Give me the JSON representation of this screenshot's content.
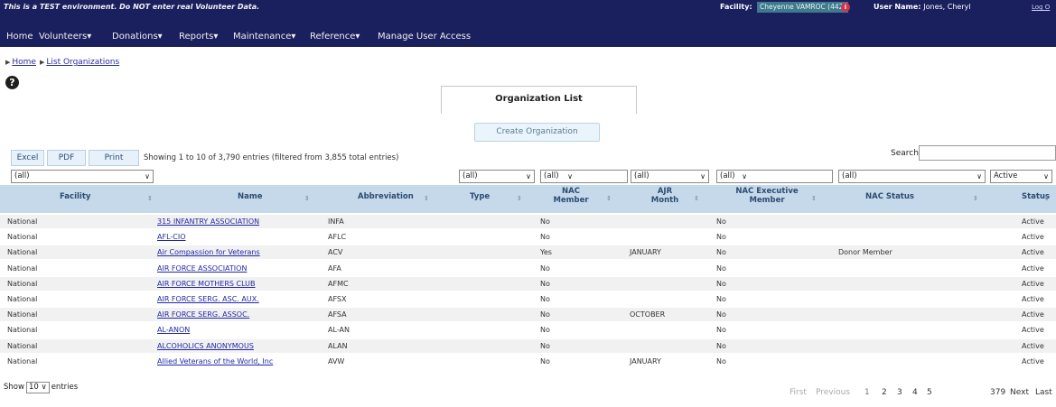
{
  "banner": {
    "warning": "This is a TEST environment. Do NOT enter real Volunteer Data.",
    "facility_label": "Facility:",
    "facility_value": "Cheyenne VAMROC (442)",
    "user_label": "User Name:",
    "user_name": "Jones, Cheryl",
    "logout": "Log O"
  },
  "nav": {
    "items": [
      "Home",
      "Volunteers",
      "Donations",
      "Reports",
      "Maintenance",
      "Reference",
      "Manage User Access"
    ]
  },
  "breadcrumb": [
    "Home",
    "List Organizations"
  ],
  "page": {
    "title": "Organization List",
    "create_button": "Create Organization"
  },
  "toolbar": {
    "excel": "Excel",
    "pdf": "PDF",
    "print": "Print",
    "showing": "Showing 1 to 10 of 3,790 entries (filtered from 3,855 total entries)",
    "search_label": "Search:"
  },
  "filters": {
    "facility": "(all)",
    "type": "(all)",
    "nac_member": "(all)",
    "ajr_month": "(all)",
    "nac_exec": "(all)",
    "nac_status": "(all)",
    "status": "Active"
  },
  "table": {
    "columns": [
      "Facility",
      "Name",
      "Abbreviation",
      "Type",
      "NAC Member",
      "AJR Month",
      "NAC Executive Member",
      "NAC Status",
      "Status"
    ],
    "rows": [
      [
        "National",
        "315 INFANTRY ASSOCIATION",
        "INFA",
        "",
        "No",
        "",
        "No",
        "",
        "Active"
      ],
      [
        "National",
        "AFL-CIO",
        "AFLC",
        "",
        "No",
        "",
        "No",
        "",
        "Active"
      ],
      [
        "National",
        "Air Compassion for Veterans",
        "ACV",
        "",
        "Yes",
        "JANUARY",
        "No",
        "Donor Member",
        "Active"
      ],
      [
        "National",
        "AIR FORCE ASSOCIATION",
        "AFA",
        "",
        "No",
        "",
        "No",
        "",
        "Active"
      ],
      [
        "National",
        "AIR FORCE MOTHERS CLUB",
        "AFMC",
        "",
        "No",
        "",
        "No",
        "",
        "Active"
      ],
      [
        "National",
        "AIR FORCE SERG. ASC. AUX.",
        "AFSX",
        "",
        "No",
        "",
        "No",
        "",
        "Active"
      ],
      [
        "National",
        "AIR FORCE SERG. ASSOC.",
        "AFSA",
        "",
        "No",
        "OCTOBER",
        "No",
        "",
        "Active"
      ],
      [
        "National",
        "AL-ANON",
        "AL-AN",
        "",
        "No",
        "",
        "No",
        "",
        "Active"
      ],
      [
        "National",
        "ALCOHOLICS ANONYMOUS",
        "ALAN",
        "",
        "No",
        "",
        "No",
        "",
        "Active"
      ],
      [
        "National",
        "Allied Veterans of the World, Inc",
        "AVW",
        "",
        "No",
        "JANUARY",
        "No",
        "",
        "Active"
      ]
    ]
  },
  "footer": {
    "show": "Show",
    "page_size": "10",
    "entries": "entries",
    "first": "First",
    "previous": "Previous",
    "pages": [
      "1",
      "2",
      "3",
      "4",
      "5"
    ],
    "ellipsis": "379",
    "next": "Next",
    "last": "Last"
  }
}
